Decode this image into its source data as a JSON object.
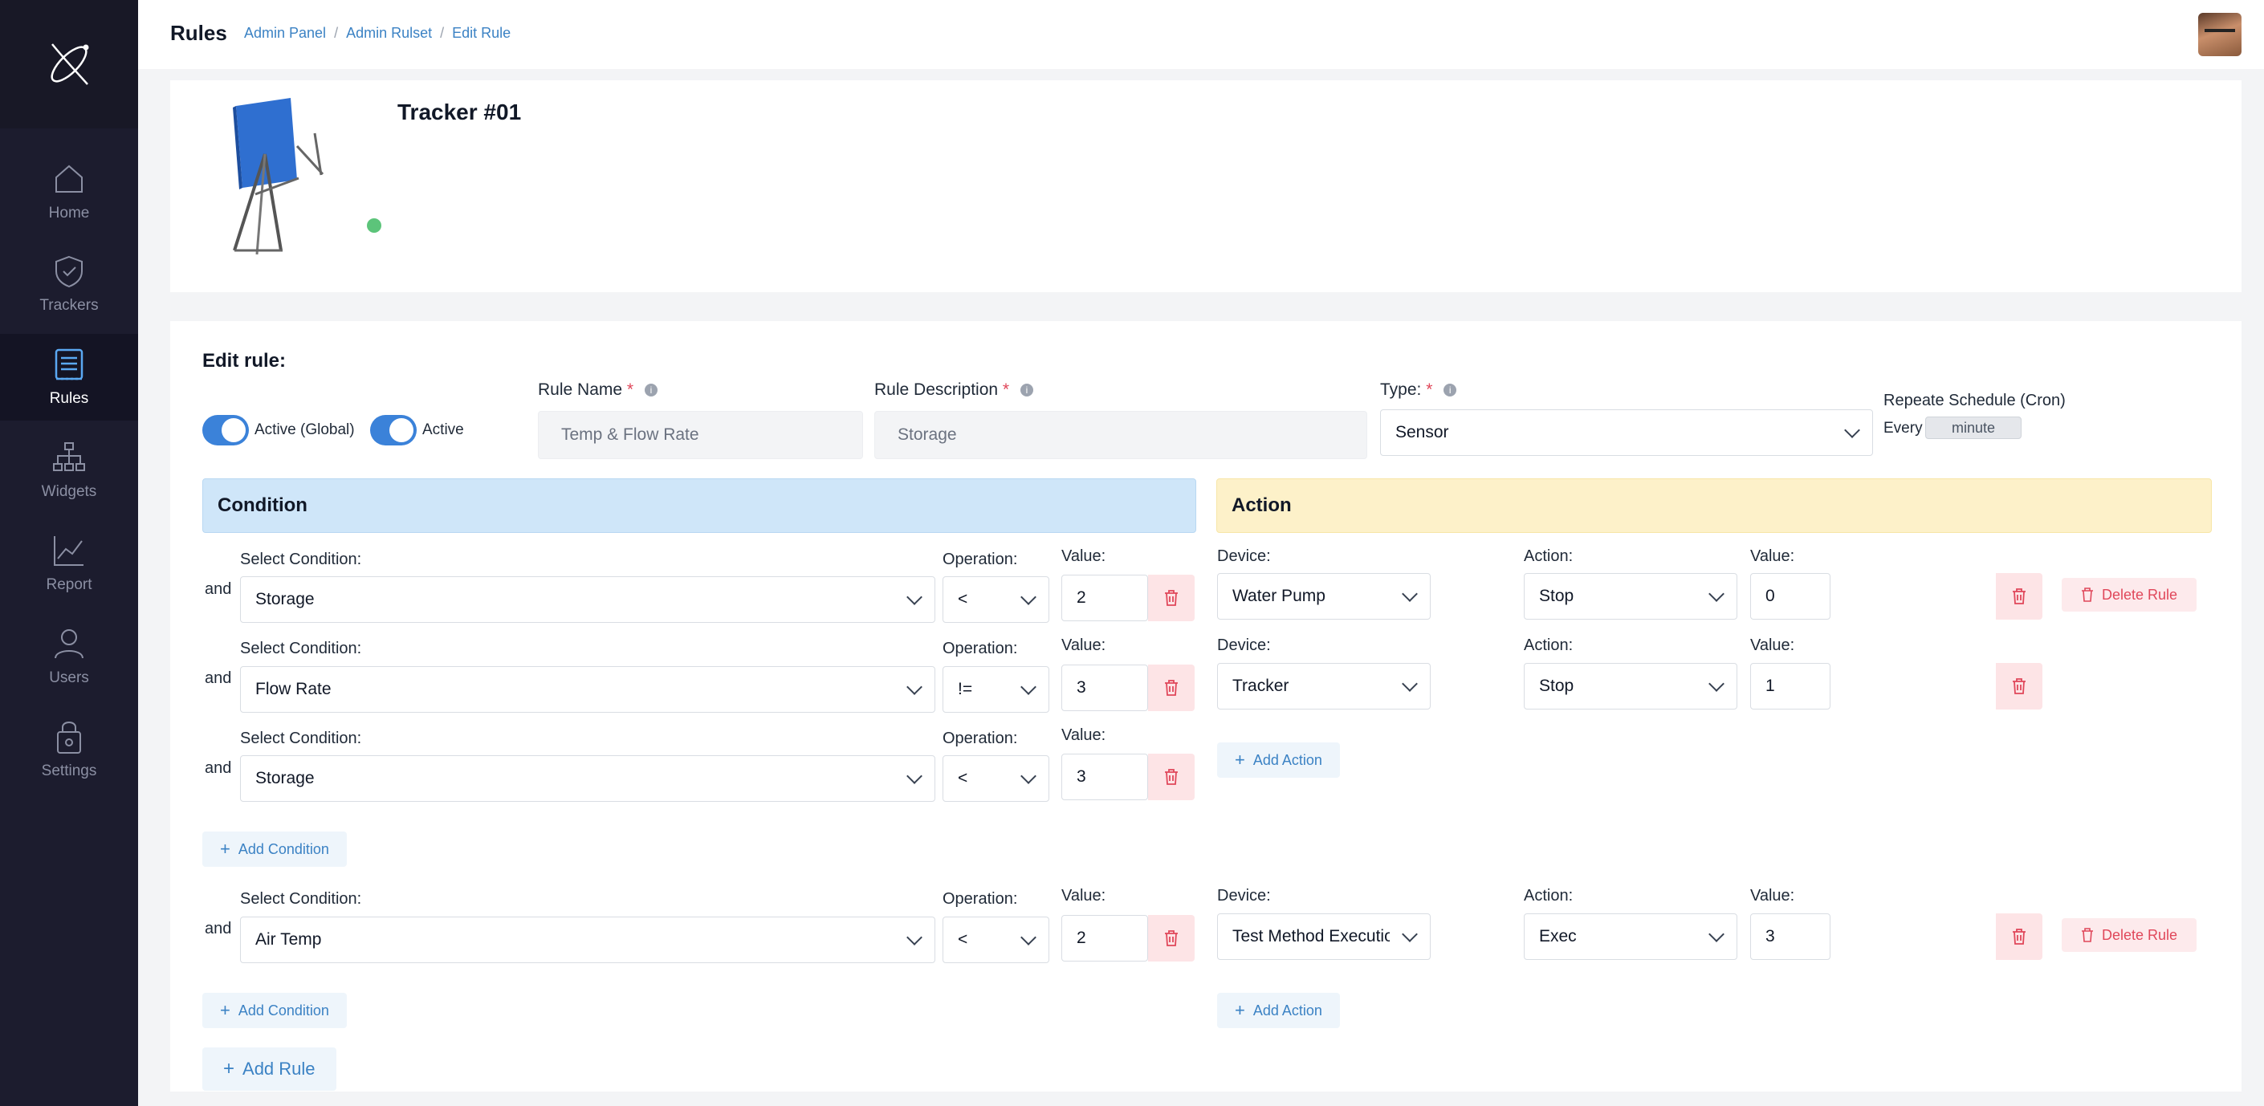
{
  "header": {
    "title": "Rules",
    "breadcrumb": [
      "Admin Panel",
      "Admin Rulset",
      "Edit Rule"
    ],
    "breadcrumb_sep": "/"
  },
  "sidebar": {
    "items": [
      {
        "label": "Home",
        "icon": "home-icon",
        "active": false
      },
      {
        "label": "Trackers",
        "icon": "shield-check-icon",
        "active": false
      },
      {
        "label": "Rules",
        "icon": "rules-list-icon",
        "active": true
      },
      {
        "label": "Widgets",
        "icon": "sitemap-icon",
        "active": false
      },
      {
        "label": "Report",
        "icon": "chart-line-icon",
        "active": false
      },
      {
        "label": "Users",
        "icon": "user-icon",
        "active": false
      },
      {
        "label": "Settings",
        "icon": "lock-settings-icon",
        "active": false
      }
    ]
  },
  "tracker": {
    "title": "Tracker #01",
    "status_color": "#5cc47a"
  },
  "edit": {
    "title": "Edit rule:",
    "toggle_global": "Active (Global)",
    "toggle_active": "Active",
    "rule_name_label": "Rule Name",
    "rule_name_value": "Temp & Flow Rate",
    "rule_desc_label": "Rule Description",
    "rule_desc_value": "Storage",
    "type_label": "Type:",
    "type_value": "Sensor",
    "required_mark": "*",
    "cron_label": "Repeate Schedule (Cron)",
    "cron_every": "Every",
    "cron_unit": "minute"
  },
  "labels": {
    "condition": "Condition",
    "action": "Action",
    "select_condition": "Select Condition:",
    "operation": "Operation:",
    "value": "Value:",
    "device": "Device:",
    "action_field": "Action:",
    "and": "and",
    "add_condition": "Add Condition",
    "add_action": "Add Action",
    "delete_rule": "Delete Rule",
    "add_rule": "Add Rule"
  },
  "rules": [
    {
      "conditions": [
        {
          "condition": "Storage",
          "operation": "<",
          "value": "2"
        },
        {
          "condition": "Flow Rate",
          "operation": "!=",
          "value": "3"
        },
        {
          "condition": "Storage",
          "operation": "<",
          "value": "3"
        }
      ],
      "actions": [
        {
          "device": "Water Pump",
          "action": "Stop",
          "value": "0"
        },
        {
          "device": "Tracker",
          "action": "Stop",
          "value": "1"
        }
      ]
    },
    {
      "conditions": [
        {
          "condition": "Air Temp",
          "operation": "<",
          "value": "2"
        }
      ],
      "actions": [
        {
          "device": "Test Method Execution",
          "action": "Exec",
          "value": "3"
        }
      ]
    }
  ],
  "colors": {
    "sidebar_bg": "#1c1c2e",
    "accent_blue": "#3b82d9",
    "condition_header": "#cfe6f9",
    "action_header": "#fdf1c9",
    "danger": "#e0475a"
  }
}
